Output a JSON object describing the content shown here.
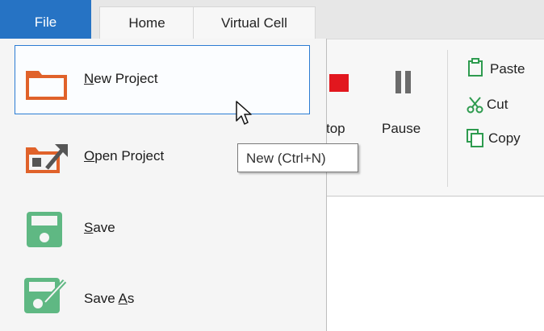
{
  "tabs": {
    "file": "File",
    "home": "Home",
    "virtual_cell": "Virtual Cell"
  },
  "ribbon": {
    "stop_label": "top",
    "pause_label": "Pause",
    "paste_label": "Paste",
    "cut_label": "Cut",
    "copy_label": "Copy"
  },
  "menu": {
    "new_project": {
      "mnemonic": "N",
      "rest": "ew Project"
    },
    "open_project": {
      "mnemonic": "O",
      "rest": "pen Project"
    },
    "save": {
      "mnemonic": "S",
      "rest": "ave"
    },
    "save_as": {
      "pre": "Save ",
      "mnemonic": "A",
      "rest": "s"
    }
  },
  "tooltip": {
    "text": "New (Ctrl+N)"
  },
  "colors": {
    "file_tab": "#2673c4",
    "new_icon": "#e0622a",
    "save_icon": "#5fb883",
    "stop_icon": "#e2171e",
    "clipboard_green": "#2e9b4f"
  },
  "icons": {
    "new_project": "folder-icon",
    "open_project": "open-folder-icon",
    "save": "floppy-disk-icon",
    "save_as": "floppy-disk-pencil-icon",
    "stop": "stop-icon",
    "pause": "pause-icon",
    "paste": "clipboard-icon",
    "cut": "scissors-icon",
    "copy": "copy-icon",
    "cursor": "mouse-pointer-icon"
  }
}
